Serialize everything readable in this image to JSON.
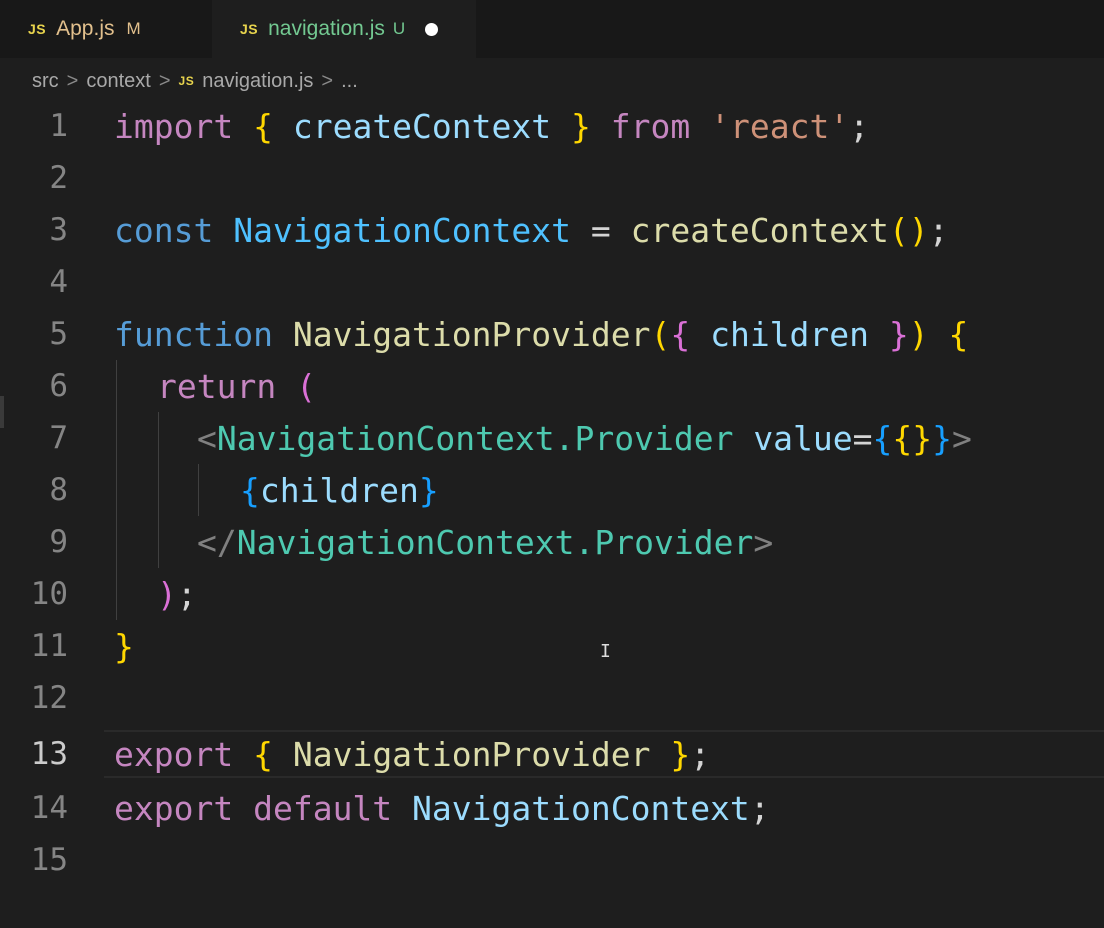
{
  "tabs": [
    {
      "icon": "JS",
      "name": "App.js",
      "status": "M",
      "active": false
    },
    {
      "icon": "JS",
      "name": "navigation.js",
      "status": "U",
      "active": true
    }
  ],
  "breadcrumb": {
    "parts": [
      "src",
      "context",
      "navigation.js",
      "..."
    ],
    "file_icon": "JS"
  },
  "editor": {
    "current_line": 13,
    "lines": [
      {
        "n": "1"
      },
      {
        "n": "2"
      },
      {
        "n": "3"
      },
      {
        "n": "4"
      },
      {
        "n": "5"
      },
      {
        "n": "6"
      },
      {
        "n": "7"
      },
      {
        "n": "8"
      },
      {
        "n": "9"
      },
      {
        "n": "10"
      },
      {
        "n": "11"
      },
      {
        "n": "12"
      },
      {
        "n": "13"
      },
      {
        "n": "14"
      },
      {
        "n": "15"
      }
    ],
    "tokens": {
      "l1": [
        "import",
        " ",
        "{",
        " ",
        "createContext",
        " ",
        "}",
        " ",
        "from",
        " ",
        "'react'",
        ";"
      ],
      "l3": [
        "const",
        " ",
        "NavigationContext",
        " = ",
        "createContext",
        "(",
        ")",
        ";"
      ],
      "l5": [
        "function",
        " ",
        "NavigationProvider",
        "(",
        "{",
        " ",
        "children",
        " ",
        "}",
        ")",
        " ",
        "{"
      ],
      "l6": [
        "return",
        " ",
        "("
      ],
      "l7": [
        "<",
        "NavigationContext.Provider",
        " ",
        "value",
        "=",
        "{",
        "{}",
        "}",
        ">"
      ],
      "l8": [
        "{",
        "children",
        "}"
      ],
      "l9": [
        "</",
        "NavigationContext.Provider",
        ">"
      ],
      "l10": [
        ")",
        ";"
      ],
      "l11": [
        "}"
      ],
      "l13": [
        "export",
        " ",
        "{",
        " ",
        "NavigationProvider",
        " ",
        "}",
        ";"
      ],
      "l14": [
        "export",
        " ",
        "default",
        " ",
        "NavigationContext",
        ";"
      ]
    }
  },
  "colors": {
    "background": "#1e1e1e",
    "tab_bar": "#181818",
    "modified": "#e2c08d",
    "untracked": "#73c991",
    "js_icon": "#e8d44d"
  }
}
